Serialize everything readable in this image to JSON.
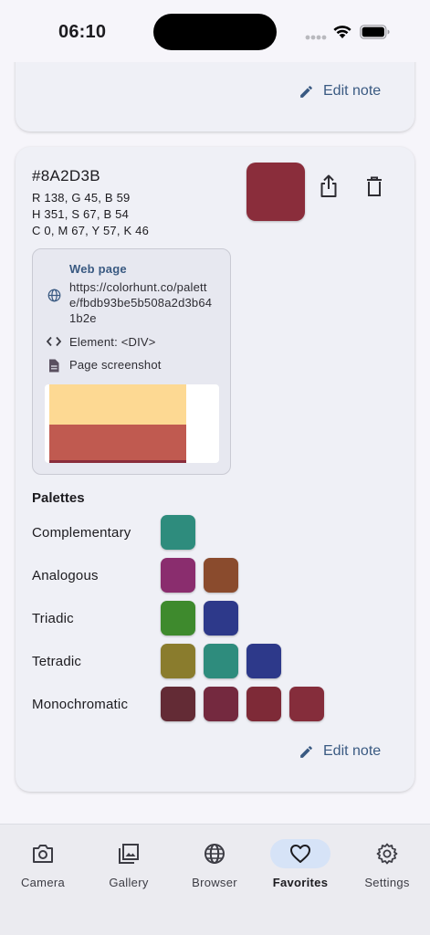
{
  "status_bar": {
    "time": "06:10"
  },
  "previous_card": {
    "edit_note_label": "Edit note"
  },
  "color_card": {
    "hex": "#8A2D3B",
    "swatch_color": "#8A2D3B",
    "rgb": "R 138, G 45, B 59",
    "hsb": "H 351, S 67, B 54",
    "cmyk": "C 0, M 67, Y 57, K 46",
    "actions": {
      "share_icon": "share-icon",
      "delete_icon": "trash-icon"
    },
    "source": {
      "title": "Web page",
      "url": "https://colorhunt.co/palette/fbdb93be5b508a2d3b641b2e",
      "element": "Element: <DIV>",
      "screenshot_label": "Page screenshot",
      "screenshot_colors": [
        "#fdd993",
        "#c05a50",
        "#8A2D3B"
      ]
    },
    "palettes_title": "Palettes",
    "palettes": [
      {
        "name": "Complementary",
        "colors": [
          "#2E8C7D"
        ]
      },
      {
        "name": "Analogous",
        "colors": [
          "#8A2D6E",
          "#8A4B2D"
        ]
      },
      {
        "name": "Triadic",
        "colors": [
          "#3E8A2D",
          "#2D398A"
        ]
      },
      {
        "name": "Tetradic",
        "colors": [
          "#8A7C2D",
          "#2E8C7D",
          "#2D398A"
        ]
      },
      {
        "name": "Monochromatic",
        "colors": [
          "#632B35",
          "#74293F",
          "#7E2A37",
          "#852D3B"
        ]
      }
    ],
    "edit_note_label": "Edit note"
  },
  "bottom_nav": {
    "items": [
      {
        "label": "Camera",
        "icon": "camera-icon",
        "active": false
      },
      {
        "label": "Gallery",
        "icon": "gallery-icon",
        "active": false
      },
      {
        "label": "Browser",
        "icon": "globe-icon",
        "active": false
      },
      {
        "label": "Favorites",
        "icon": "heart-icon",
        "active": true
      },
      {
        "label": "Settings",
        "icon": "gear-icon",
        "active": false
      }
    ]
  },
  "colors": {
    "accent": "#3a5a82",
    "nav_active_pill": "#d6e3f7"
  }
}
